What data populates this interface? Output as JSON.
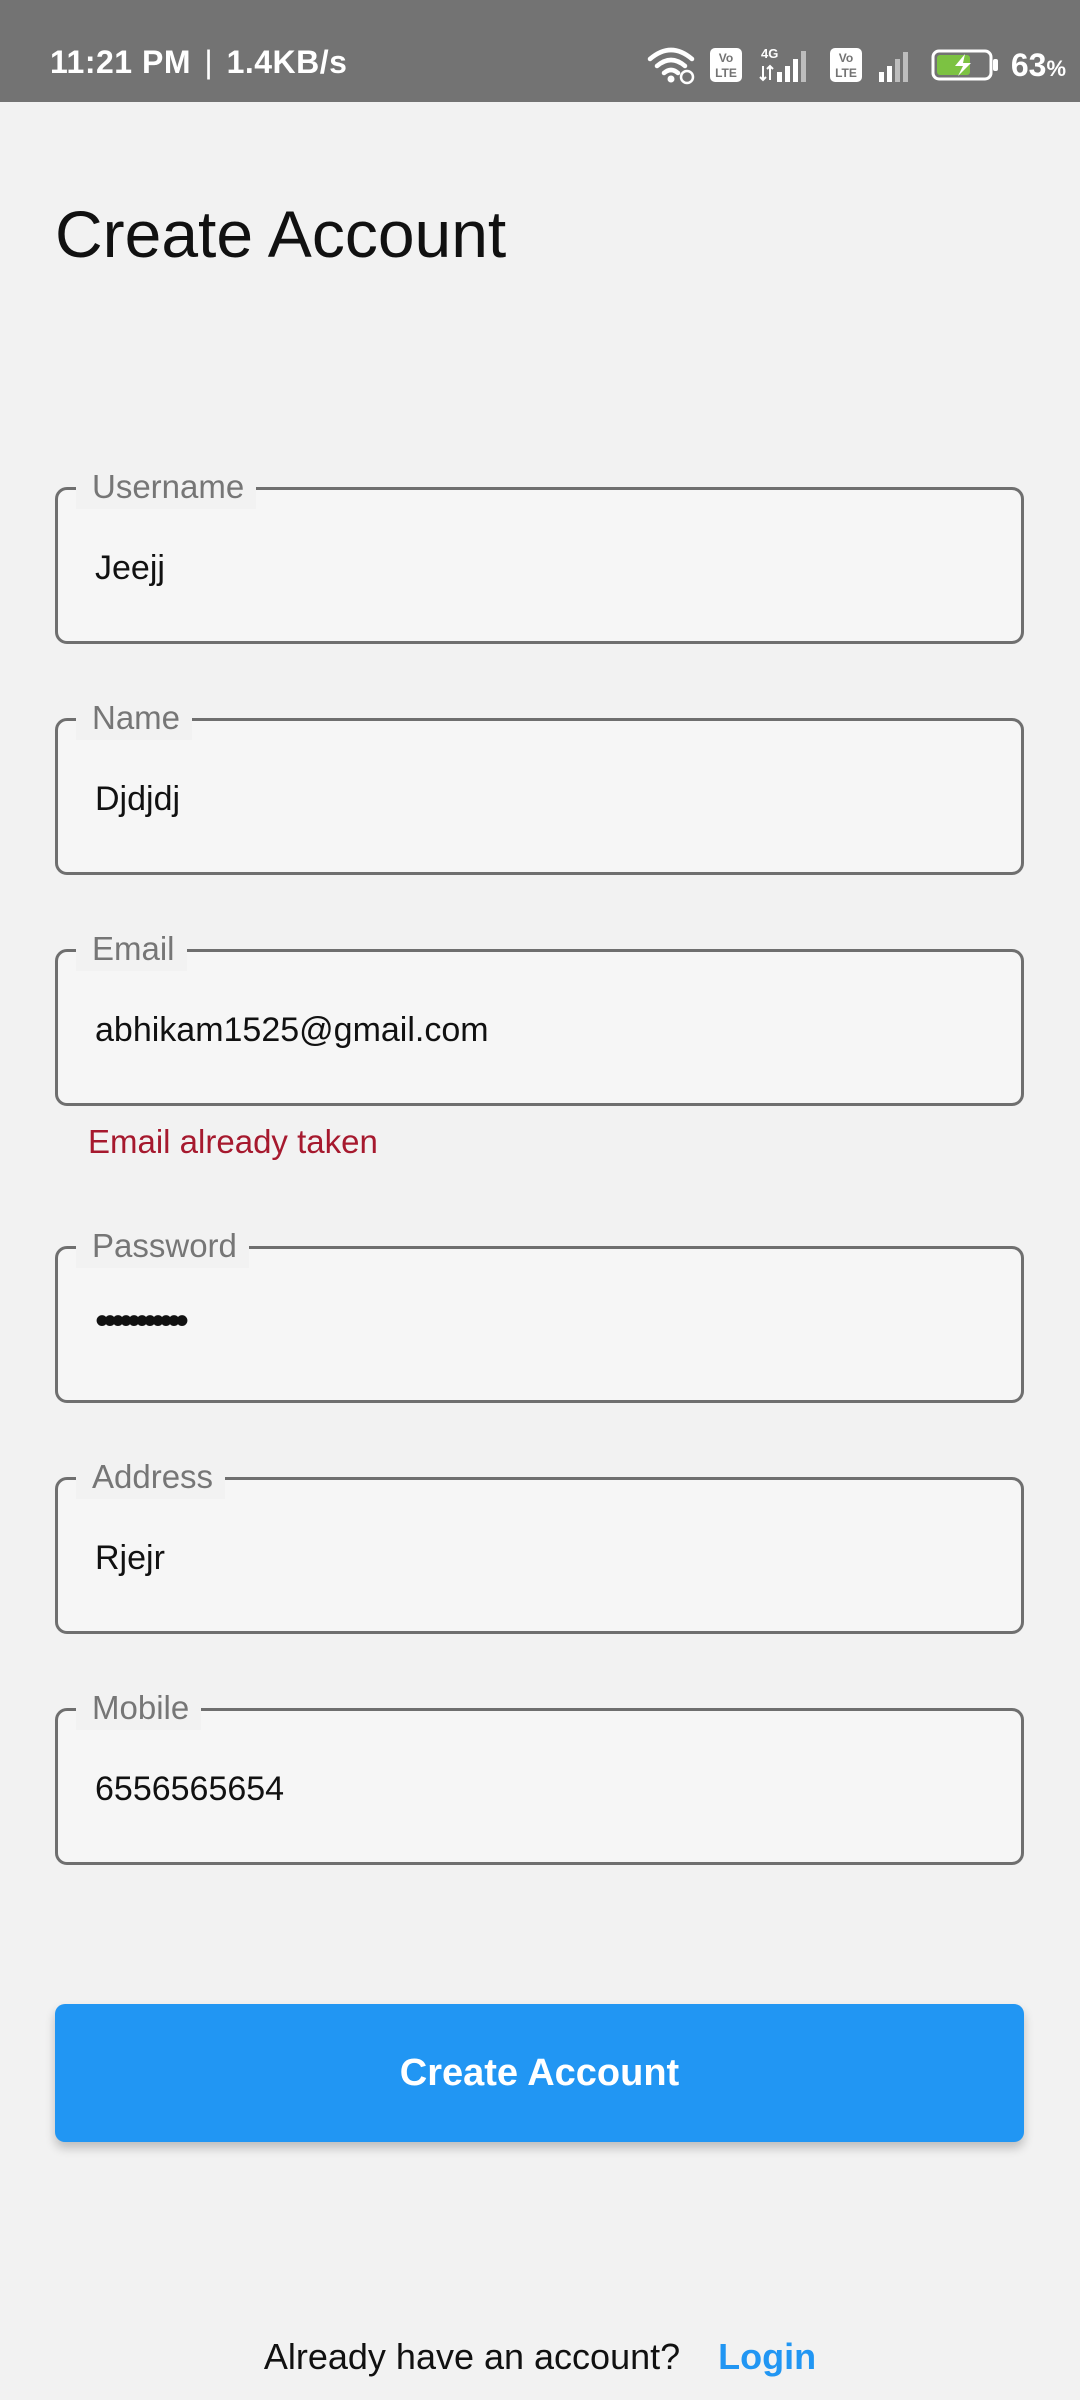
{
  "status_bar": {
    "time": "11:21 PM",
    "separator": "|",
    "net_speed": "1.4KB/s",
    "sim1_badge_top": "Vo",
    "sim1_badge_bottom": "LTE",
    "network_type": "4G",
    "sim2_badge_top": "Vo",
    "sim2_badge_bottom": "LTE",
    "battery_percent": "63",
    "battery_unit": "%",
    "icons": [
      "wifi-icon",
      "volte-icon",
      "signal-icon",
      "volte-icon",
      "signal-icon",
      "battery-charging-icon"
    ]
  },
  "page": {
    "title": "Create Account"
  },
  "form": {
    "username": {
      "label": "Username",
      "value": "Jeejj"
    },
    "name": {
      "label": "Name",
      "value": "Djdjdj"
    },
    "email": {
      "label": "Email",
      "value": "abhikam1525@gmail.com",
      "error": "Email already taken"
    },
    "password": {
      "label": "Password",
      "value": "•••••••••••"
    },
    "address": {
      "label": "Address",
      "value": "Rjejr"
    },
    "mobile": {
      "label": "Mobile",
      "value": "6556565654"
    },
    "submit_label": "Create Account"
  },
  "footer": {
    "prompt": "Already have an account?",
    "link_label": "Login"
  },
  "colors": {
    "accent": "#2196f3",
    "error": "#a6192e",
    "status_bar_bg": "#737373",
    "background": "#f2f2f2"
  }
}
